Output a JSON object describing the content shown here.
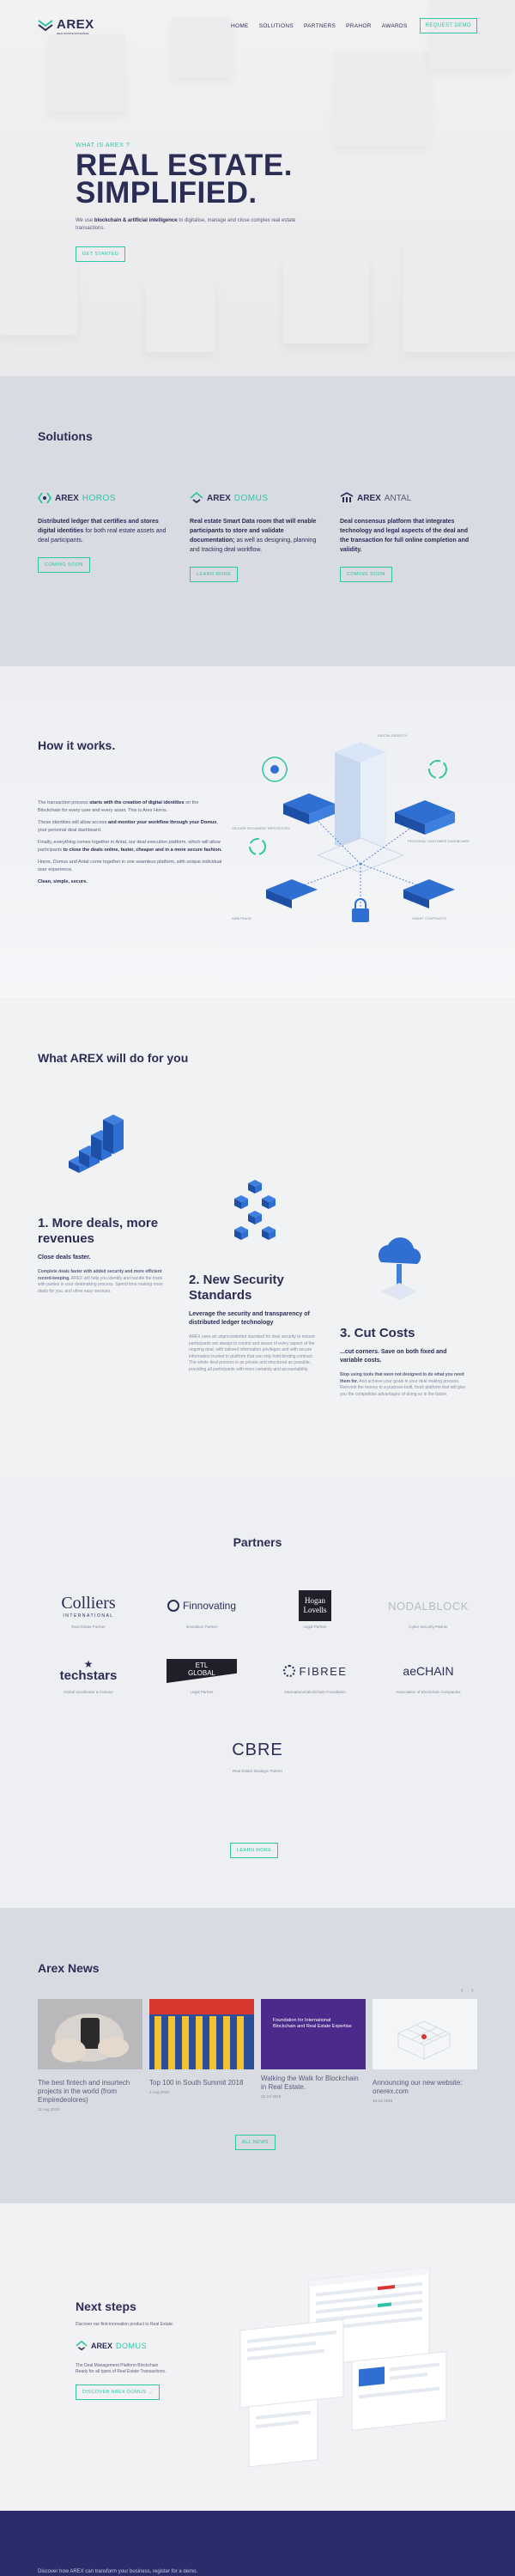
{
  "brand": {
    "name": "AREX",
    "tagline": "REAL ESTATE EXCHANGE"
  },
  "nav": {
    "items": [
      "HOME",
      "SOLUTIONS",
      "PARTNERS",
      "PRAHOR",
      "AWARDS"
    ],
    "cta": "REQUEST DEMO"
  },
  "hero": {
    "eyebrow": "WHAT IS AREX ?",
    "title_line1": "REAL ESTATE.",
    "title_line2": "SIMPLIFIED.",
    "text_prefix": "We use ",
    "text_bold": "blockchain & artificial intelligence",
    "text_suffix": " to digitalise, manage and close complex real estate transactions.",
    "cta": "GET STARTED"
  },
  "solutions": {
    "title": "Solutions",
    "items": [
      {
        "brand": "AREX",
        "product": "HOROS",
        "text_bold": "Distributed ledger that certifies and stores digital identities",
        "text": " for both real estate assets and deal participants.",
        "cta": "COMING SOON"
      },
      {
        "brand": "AREX",
        "product": "DOMUS",
        "text_bold": "Real estate Smart Data room that will enable participants to store and validate documentation;",
        "text": " as well as designing, planning and tracking deal workflow.",
        "cta": "LEARN MORE"
      },
      {
        "brand": "AREX",
        "product": "ANTAL",
        "text_bold": "Deal consensus platform that integrates technology and legal aspects of the deal and the transaction for full online completion and validity.",
        "text": "",
        "cta": "COMING SOON"
      }
    ]
  },
  "how": {
    "title": "How it works.",
    "paragraphs": [
      {
        "pre": "The transaction process ",
        "bold": "starts with the creation of digital identities",
        "post": " on the Blockchain for every user and every asset. This is Arex Horos."
      },
      {
        "pre": "These identities will allow access ",
        "bold": "and monitor your workflow through your Domus",
        "post": ", your personal deal dashboard."
      },
      {
        "pre": "Finally, everything comes together in Antal, our deal execution platform, which will allow participants ",
        "bold": "to close the deals online, faster, cheaper and in a more secure fashion.",
        "post": ""
      },
      {
        "pre": "Horos, Domus and Antal come together in one seamless platform, with unique individual user experience.",
        "bold": "",
        "post": ""
      },
      {
        "pre": "",
        "bold": "Clean, simple, secure.",
        "post": ""
      }
    ],
    "labels": [
      "DIGITAL IDENTITY",
      "SECURE DOCUMENT REPOSITORY",
      "ARBITRAGE",
      "SMART CONTRACTS",
      "PERSONAL CUSTOMER DASHBOARD"
    ]
  },
  "what": {
    "title": "What AREX will do for you",
    "features": [
      {
        "title": "1. More deals, more revenues",
        "subtitle": "Close deals faster.",
        "text_bold": "Complete deals faster with added security and more efficient record-keeping.",
        "text": " AREX will help you identify and handle the trade with parties in your dealmaking process. Spend time making more deals for you, and other easy services."
      },
      {
        "title": "2. New Security Standards",
        "subtitle": "Leverage the security and transparency of distributed ledger technology",
        "text_bold": "",
        "text": "AREX uses an unprecedented standard for deal security to ensure participants are always in control and aware of every aspect of the ongoing deal, with tailored information privileges and with secure information trusted to platform that can only hold binding contract. The whole deal process is as private and structured as possible, providing all participants with more certainty and accountability."
      },
      {
        "title": "3. Cut Costs",
        "subtitle": "...cut corners. Save on both fixed and variable costs.",
        "text_bold": "Stop using tools that were not designed to do what you need them for.",
        "text": " And achieve your goals in your deal making process. Reinvest the money to a purpose-built, fresh platform that will give you the competitive advantages of doing so in the future."
      }
    ]
  },
  "partners": {
    "title": "Partners",
    "items": [
      {
        "logo_line1": "Colliers",
        "logo_line2": "INTERNATIONAL",
        "caption": "Real Estate Partner"
      },
      {
        "logo_line1": "Finnovating",
        "logo_line2": "",
        "caption": "Innovation Partner"
      },
      {
        "logo_line1": "Hogan",
        "logo_line2": "Lovells",
        "caption": "Legal Partner"
      },
      {
        "logo_line1": "NODALBLOCK",
        "logo_line2": "",
        "caption": "Cyber Security Partner"
      },
      {
        "logo_line1": "techstars",
        "logo_line2": "",
        "caption": "Global accelerator & investor"
      },
      {
        "logo_line1": "ETL",
        "logo_line2": "GLOBAL",
        "caption": "Legal Partner"
      },
      {
        "logo_line1": "FIBREE",
        "logo_line2": "",
        "caption": "International Blockchain Foundation"
      },
      {
        "logo_line1": "aeCHAIN",
        "logo_line2": "",
        "caption": "Association of Blockchain Companies"
      },
      {
        "logo_line1": "CBRE",
        "logo_line2": "",
        "caption": "Real Estate Strategic Partner"
      }
    ],
    "cta": "LEARN MORE"
  },
  "news": {
    "title": "Arex News",
    "items": [
      {
        "title": "The best fintech and insurtech projects in the world (from Empiredeolores)",
        "date": "11 Aug 2018"
      },
      {
        "title": "Top 100 in South Summit 2018",
        "date": "3 Aug 2018"
      },
      {
        "title": "Walking the Walk for Blockchain in Real Estate.",
        "date": "22 Jul 2018"
      },
      {
        "title": "Announcing our new website: onerex.com",
        "date": "18 Jul 2018"
      }
    ],
    "image_caption": "Foundation for International Blockchain and Real Estate Expertise",
    "cta": "ALL NEWS"
  },
  "next": {
    "title": "Next steps",
    "intro": "Discover our first-innovation product to Real Estate:",
    "product_brand": "AREX",
    "product_name": "DOMUS",
    "text": "The Deal Management Platform Blockchain Ready for all types of Real Estate Transactions.",
    "cta": "DISCOVER AREX DOMUS →"
  },
  "footer": {
    "text": "Discover how AREX can transform your business, register for a demo."
  },
  "colors": {
    "accent": "#2ec4a4",
    "navy": "#2b2d55",
    "blue": "#2f6fd1",
    "footer": "#2b2d6a"
  }
}
